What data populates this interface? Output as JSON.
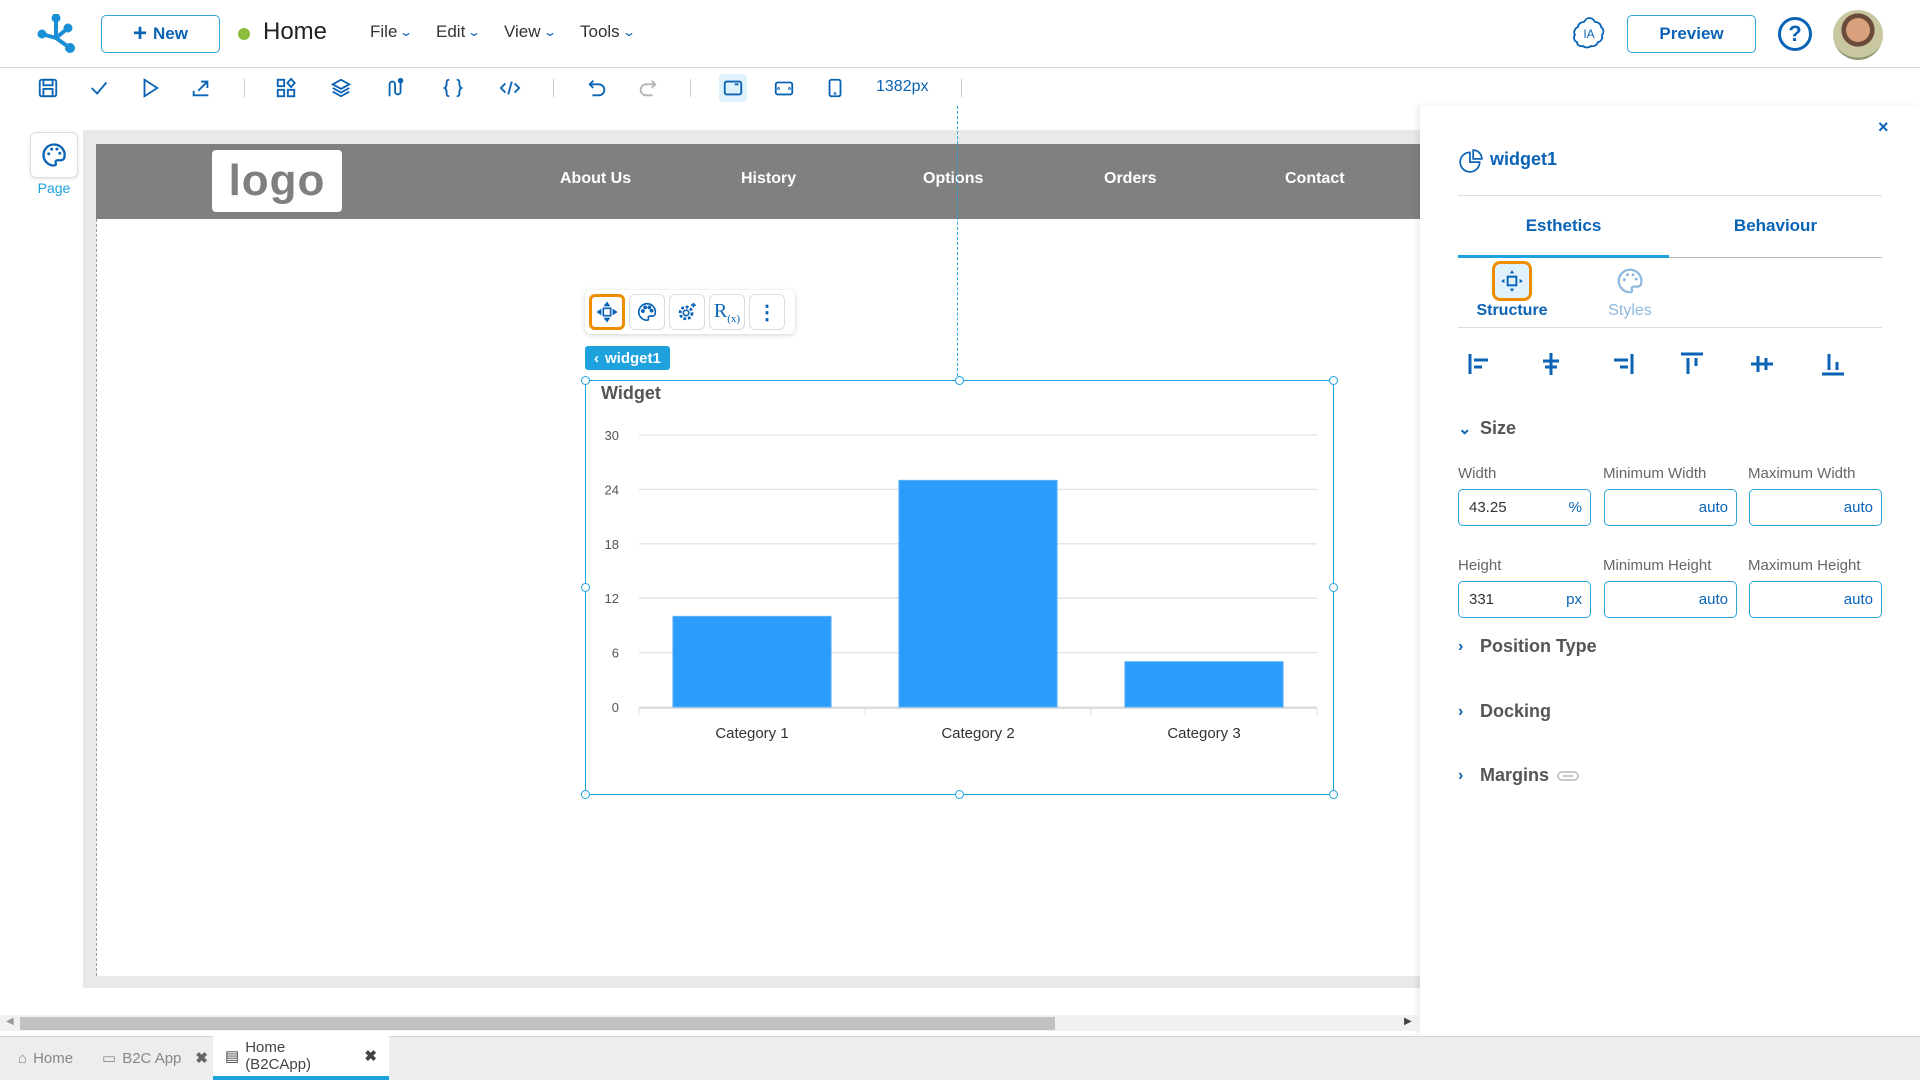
{
  "topbar": {
    "new_label": "New",
    "page_name": "Home",
    "status_color": "#8cbd3f",
    "menus": [
      "File",
      "Edit",
      "View",
      "Tools"
    ],
    "ia_label": "IA",
    "preview_label": "Preview",
    "help_glyph": "?"
  },
  "toolbar": {
    "icons": [
      "save-icon",
      "check-icon",
      "play-icon",
      "publish-icon",
      "components-icon",
      "layers-icon",
      "flows-icon",
      "braces-icon",
      "code-icon",
      "undo-icon",
      "redo-icon",
      "desktop-view-icon",
      "tablet-view-icon",
      "mobile-view-icon"
    ],
    "width_readout": "1382px"
  },
  "canvas": {
    "page_button_label": "Page",
    "site_logo": "logo",
    "nav_links": [
      "About Us",
      "History",
      "Options",
      "Orders",
      "Contact"
    ],
    "widget_toolbar": {
      "rx_label": "R",
      "rx_sub": "(x)"
    },
    "widget_tag": "widget1",
    "widget_title": "Widget"
  },
  "chart_data": {
    "type": "bar",
    "title": "Widget",
    "categories": [
      "Category 1",
      "Category 2",
      "Category 3"
    ],
    "values": [
      10,
      25,
      5
    ],
    "yticks": [
      0,
      6,
      12,
      18,
      24,
      30
    ],
    "ylim": [
      0,
      30
    ],
    "xlabel": "",
    "ylabel": "",
    "grid": true,
    "bar_color": "#2b9cf9"
  },
  "panel": {
    "close_glyph": "×",
    "widget_name": "widget1",
    "tabs": [
      "Esthetics",
      "Behaviour"
    ],
    "subtabs": [
      "Structure",
      "Styles"
    ],
    "sections": {
      "size": "Size",
      "position_type": "Position Type",
      "docking": "Docking",
      "margins": "Margins"
    },
    "fields": {
      "width": {
        "label": "Width",
        "value": "43.25",
        "unit": "%"
      },
      "min_width": {
        "label": "Minimum Width",
        "value": "auto"
      },
      "max_width": {
        "label": "Maximum Width",
        "value": "auto"
      },
      "height": {
        "label": "Height",
        "value": "331",
        "unit": "px"
      },
      "min_height": {
        "label": "Minimum Height",
        "value": "auto"
      },
      "max_height": {
        "label": "Maximum Height",
        "value": "auto"
      }
    }
  },
  "bottom_tabs": [
    {
      "label": "Home",
      "closable": false
    },
    {
      "label": "B2C App",
      "closable": true
    },
    {
      "label": "Home (B2CApp)",
      "closable": true,
      "active": true
    }
  ],
  "colors": {
    "accent": "#0a63b5",
    "highlight": "#1ea2de",
    "selection": "#f08c00"
  }
}
